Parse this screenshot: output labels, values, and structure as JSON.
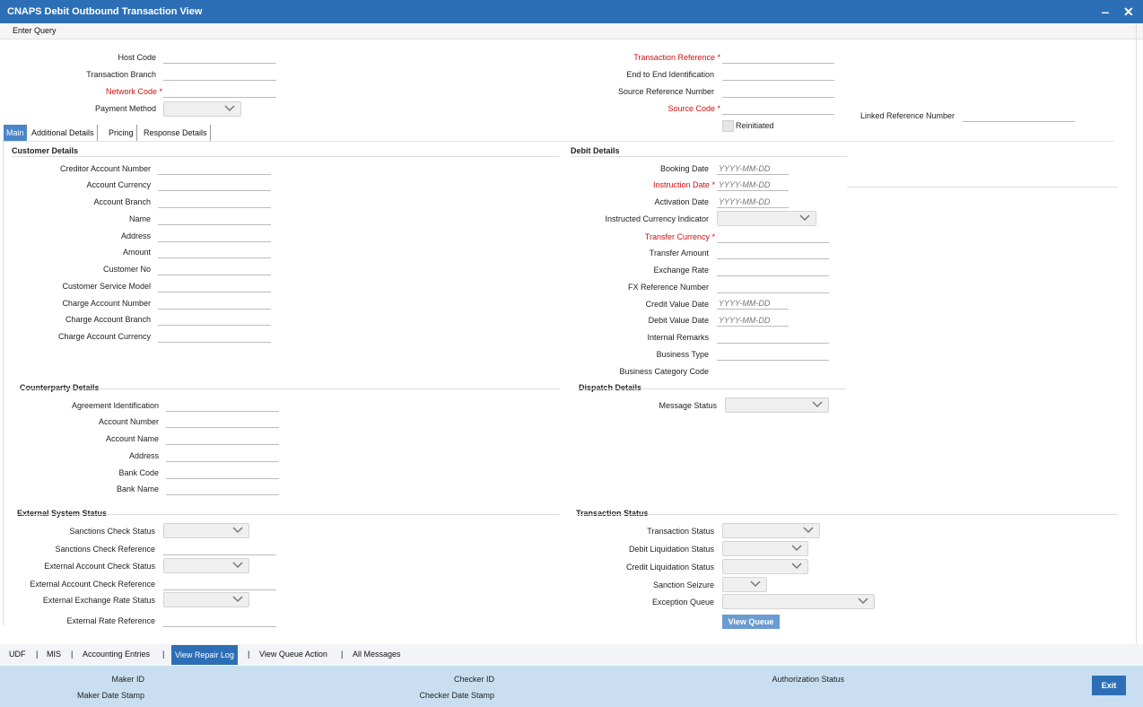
{
  "window": {
    "title": "CNAPS Debit Outbound Transaction View",
    "minimize": "‒",
    "close": "✕"
  },
  "menu": {
    "enter_query": "Enter Query"
  },
  "header": {
    "host_code": "Host Code",
    "transaction_branch": "Transaction Branch",
    "network_code": "Network Code",
    "payment_method": "Payment Method",
    "transaction_reference": "Transaction Reference",
    "end_to_end": "End to End Identification",
    "source_reference_number": "Source Reference Number",
    "source_code": "Source Code",
    "reinitiated": "Reinitiated",
    "linked_reference_number": "Linked Reference Number"
  },
  "tabs": [
    "Main",
    "Additional Details",
    "Pricing",
    "Response Details"
  ],
  "customer": {
    "title": "Customer Details",
    "labels": [
      "Creditor Account Number",
      "Account Currency",
      "Account Branch",
      "Name",
      "Address",
      "Amount",
      "Customer No",
      "Customer Service Model",
      "Charge Account Number",
      "Charge Account Branch",
      "Charge Account Currency"
    ]
  },
  "debit": {
    "title": "Debit Details",
    "booking_date": "Booking Date",
    "instruction_date": "Instruction Date",
    "activation_date": "Activation Date",
    "instructed_currency_indicator": "Instructed Currency Indicator",
    "transfer_currency": "Transfer Currency",
    "transfer_amount": "Transfer Amount",
    "exchange_rate": "Exchange Rate",
    "fx_reference_number": "FX Reference Number",
    "credit_value_date": "Credit Value Date",
    "debit_value_date": "Debit Value Date",
    "internal_remarks": "Internal Remarks",
    "business_type": "Business Type",
    "business_category_code": "Business Category Code",
    "date_placeholder": "YYYY-MM-DD"
  },
  "counterparty": {
    "title": "Counterparty Details",
    "labels": [
      "Agreement Identification",
      "Account Number",
      "Account Name",
      "Address",
      "Bank Code",
      "Bank Name"
    ]
  },
  "dispatch": {
    "title": "Dispatch Details",
    "message_status": "Message Status"
  },
  "external": {
    "title": "External System Status",
    "sanctions_check_status": "Sanctions Check Status",
    "sanctions_check_reference": "Sanctions Check Reference",
    "external_account_check_status": "External Account Check Status",
    "external_account_check_reference": "External Account Check Reference",
    "external_exchange_rate_status": "External Exchange Rate Status",
    "external_rate_reference": "External Rate Reference"
  },
  "txn_status": {
    "title": "Transaction Status",
    "transaction_status": "Transaction Status",
    "debit_liquidation_status": "Debit Liquidation Status",
    "credit_liquidation_status": "Credit Liquidation Status",
    "sanction_seizure": "Sanction Seizure",
    "exception_queue": "Exception Queue",
    "view_queue": "View Queue"
  },
  "bottom_nav": [
    "UDF",
    "MIS",
    "Accounting Entries",
    "View Repair Log",
    "View Queue Action",
    "All Messages"
  ],
  "footer": {
    "maker_id": "Maker ID",
    "maker_date_stamp": "Maker Date Stamp",
    "checker_id": "Checker ID",
    "checker_date_stamp": "Checker Date Stamp",
    "authorization_status": "Authorization Status",
    "exit": "Exit"
  }
}
